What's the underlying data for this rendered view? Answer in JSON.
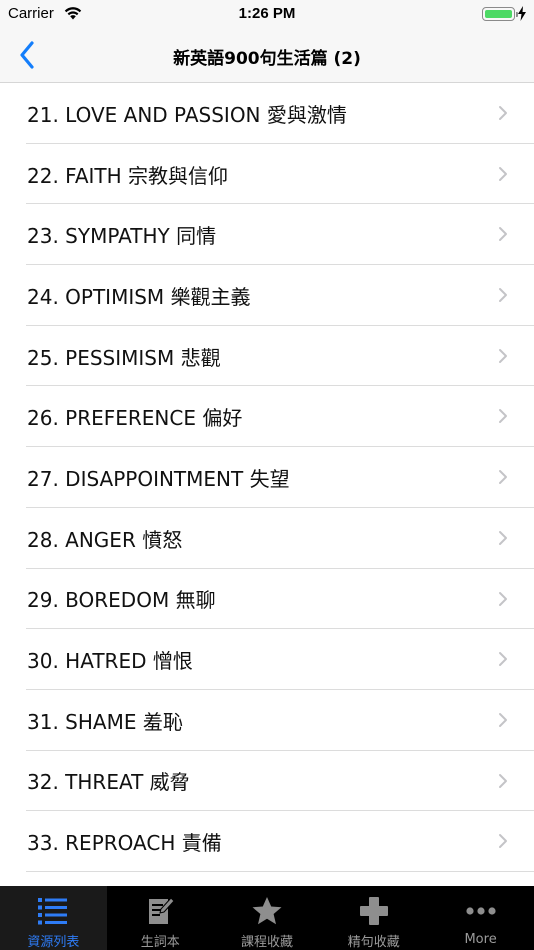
{
  "status_bar": {
    "carrier": "Carrier",
    "time": "1:26 PM"
  },
  "nav": {
    "title": "新英語900句生活篇 (2)",
    "back_icon": "chevron-left-icon",
    "accent_color": "#147efb"
  },
  "list": {
    "items": [
      {
        "label": "21. LOVE AND PASSION 愛與激情"
      },
      {
        "label": "22. FAITH 宗教與信仰"
      },
      {
        "label": "23. SYMPATHY 同情"
      },
      {
        "label": "24. OPTIMISM 樂觀主義"
      },
      {
        "label": "25. PESSIMISM 悲觀"
      },
      {
        "label": "26. PREFERENCE 偏好"
      },
      {
        "label": "27. DISAPPOINTMENT 失望"
      },
      {
        "label": "28. ANGER 憤怒"
      },
      {
        "label": "29. BOREDOM 無聊"
      },
      {
        "label": "30. HATRED 憎恨"
      },
      {
        "label": "31. SHAME 羞恥"
      },
      {
        "label": "32. THREAT 威脅"
      },
      {
        "label": "33. REPROACH 責備"
      }
    ]
  },
  "tab_bar": {
    "tabs": [
      {
        "label": "資源列表",
        "icon": "list-icon",
        "active": true
      },
      {
        "label": "生詞本",
        "icon": "notebook-edit-icon",
        "active": false
      },
      {
        "label": "課程收藏",
        "icon": "star-icon",
        "active": false
      },
      {
        "label": "精句收藏",
        "icon": "plus-icon",
        "active": false
      },
      {
        "label": "More",
        "icon": "more-dots-icon",
        "active": false
      }
    ],
    "active_color": "#2e7cf6",
    "inactive_color": "#9a9a9a"
  }
}
